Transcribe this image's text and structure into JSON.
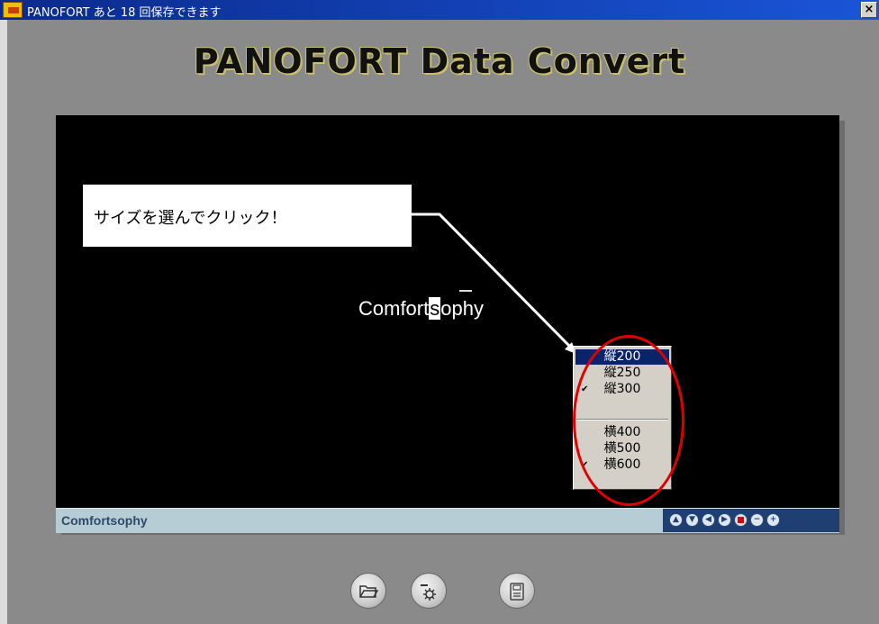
{
  "window": {
    "title": "PANOFORT あと 18 回保存できます",
    "close_label": "×"
  },
  "app": {
    "heading": "PANOFORT Data Convert"
  },
  "viewer": {
    "logo_pre": "Comfort",
    "logo_s": "s",
    "logo_post": "ophy",
    "callout": "サイズを選んでクリック！"
  },
  "size_menu": {
    "items": [
      {
        "label": "縦200",
        "checked": false,
        "selected": true
      },
      {
        "label": "縦250",
        "checked": false,
        "selected": false
      },
      {
        "label": "縦300",
        "checked": true,
        "selected": false
      },
      {
        "label": "横400",
        "checked": false,
        "selected": false
      },
      {
        "label": "横500",
        "checked": false,
        "selected": false
      },
      {
        "label": "横600",
        "checked": true,
        "selected": false
      }
    ],
    "check_mark": "✔"
  },
  "status": {
    "label": "Comfortsophy"
  },
  "nav_icons": [
    "up-icon",
    "down-icon",
    "left-icon",
    "right-icon",
    "stop-icon",
    "zoom-out-icon",
    "zoom-in-icon"
  ],
  "toolbar": {
    "buttons": [
      "open-folder-icon",
      "settings-icon",
      "save-icon"
    ]
  },
  "colors": {
    "highlight_ellipse": "#e00000",
    "menu_selection": "#0a246a",
    "viewer_bg": "#000000"
  }
}
